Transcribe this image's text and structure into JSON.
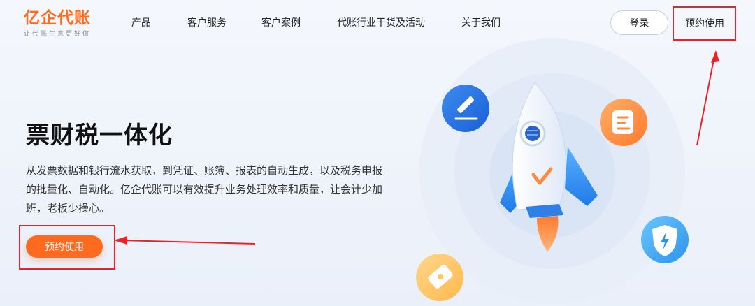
{
  "header": {
    "logo": {
      "main": "亿企代账",
      "tagline": "让代账生意更好做"
    },
    "nav": [
      "产品",
      "客户服务",
      "客户案例",
      "代账行业干货及活动",
      "关于我们"
    ],
    "login_label": "登录",
    "trial_label": "预约使用"
  },
  "hero": {
    "title": "票财税一体化",
    "description": "从发票数据和银行流水获取，到凭证、账簿、报表的自动生成，以及税务申报的批量化、自动化。亿企代账可以有效提升业务处理效率和质量，让会计少加班，老板少操心。",
    "cta_label": "预约使用"
  },
  "colors": {
    "brand": "#ff6a1f",
    "annotation": "#e8242a",
    "icon_blue": "#1f6fe0",
    "icon_orange": "#ff8a3d",
    "icon_sky": "#3aa6f0",
    "icon_yellow": "#ffc766"
  },
  "icons": [
    "pencil-icon",
    "document-icon",
    "shield-icon",
    "ticket-icon",
    "rocket-illustration"
  ]
}
